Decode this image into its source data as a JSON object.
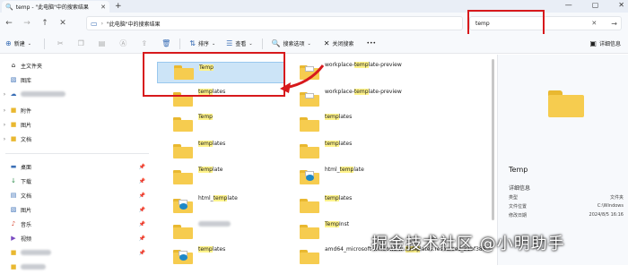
{
  "tab": {
    "title": "temp - \"此电脑\"中的搜索结果"
  },
  "address": {
    "path": "\"此电脑\"中的搜索结果"
  },
  "search": {
    "value": "temp"
  },
  "toolbar": {
    "new_label": "新建",
    "sort_label": "排序",
    "view_label": "查看",
    "search_options_label": "搜索选项",
    "close_search_label": "关闭搜索",
    "more_label": "•••",
    "details_label": "详细信息"
  },
  "sidebar": {
    "quick_access": "主文件夹",
    "gallery": "图库",
    "folders": [
      "附件",
      "图片",
      "文档"
    ],
    "pinned": [
      "桌面",
      "下载",
      "文档",
      "图片",
      "音乐",
      "视频"
    ]
  },
  "results": [
    {
      "name": "Temp",
      "match": "Temp",
      "rest": ""
    },
    {
      "name": "workplace-template-preview",
      "pre": "workplace-",
      "match": "temp",
      "rest": "late-preview"
    },
    {
      "name": "templates",
      "match": "temp",
      "rest": "lates"
    },
    {
      "name": "workplace-template-preview",
      "pre": "workplace-",
      "match": "temp",
      "rest": "late-preview"
    },
    {
      "name": "Temp",
      "match": "Temp",
      "rest": ""
    },
    {
      "name": "templates",
      "match": "temp",
      "rest": "lates"
    },
    {
      "name": "templates",
      "match": "temp",
      "rest": "lates"
    },
    {
      "name": "templates",
      "match": "temp",
      "rest": "lates"
    },
    {
      "name": "Template",
      "match": "Temp",
      "rest": "late"
    },
    {
      "name": "html_template",
      "pre": "html_",
      "match": "temp",
      "rest": "late"
    },
    {
      "name": "html_template",
      "pre": "html_",
      "match": "temp",
      "rest": "late"
    },
    {
      "name": "templates",
      "match": "temp",
      "rest": "lates"
    },
    {
      "name": "",
      "match": "",
      "rest": ""
    },
    {
      "name": "TempInst",
      "match": "Temp",
      "rest": "Inst"
    },
    {
      "name": "templates",
      "match": "temp",
      "rest": "lates"
    },
    {
      "name": "amd64_microsoft-windows-w..templates.resources_31bf385",
      "pre": "amd64_microsoft-windows-w..",
      "match": "temp",
      "rest": "lates.resources_31bf385"
    }
  ],
  "details": {
    "name": "Temp",
    "section": "详细信息",
    "type_label": "类型",
    "type_value": "文件夹",
    "location_label": "文件位置",
    "location_value": "C:\\Windows",
    "modified_label": "修改日期",
    "modified_value": "2024/8/5 16:16"
  },
  "watermark": "掘金技术社区 @小明助手",
  "colors": {
    "accent": "#3b6fb6",
    "highlight": "#fff38a",
    "annotation_red": "#d7191c",
    "selection": "#cce4f7"
  }
}
